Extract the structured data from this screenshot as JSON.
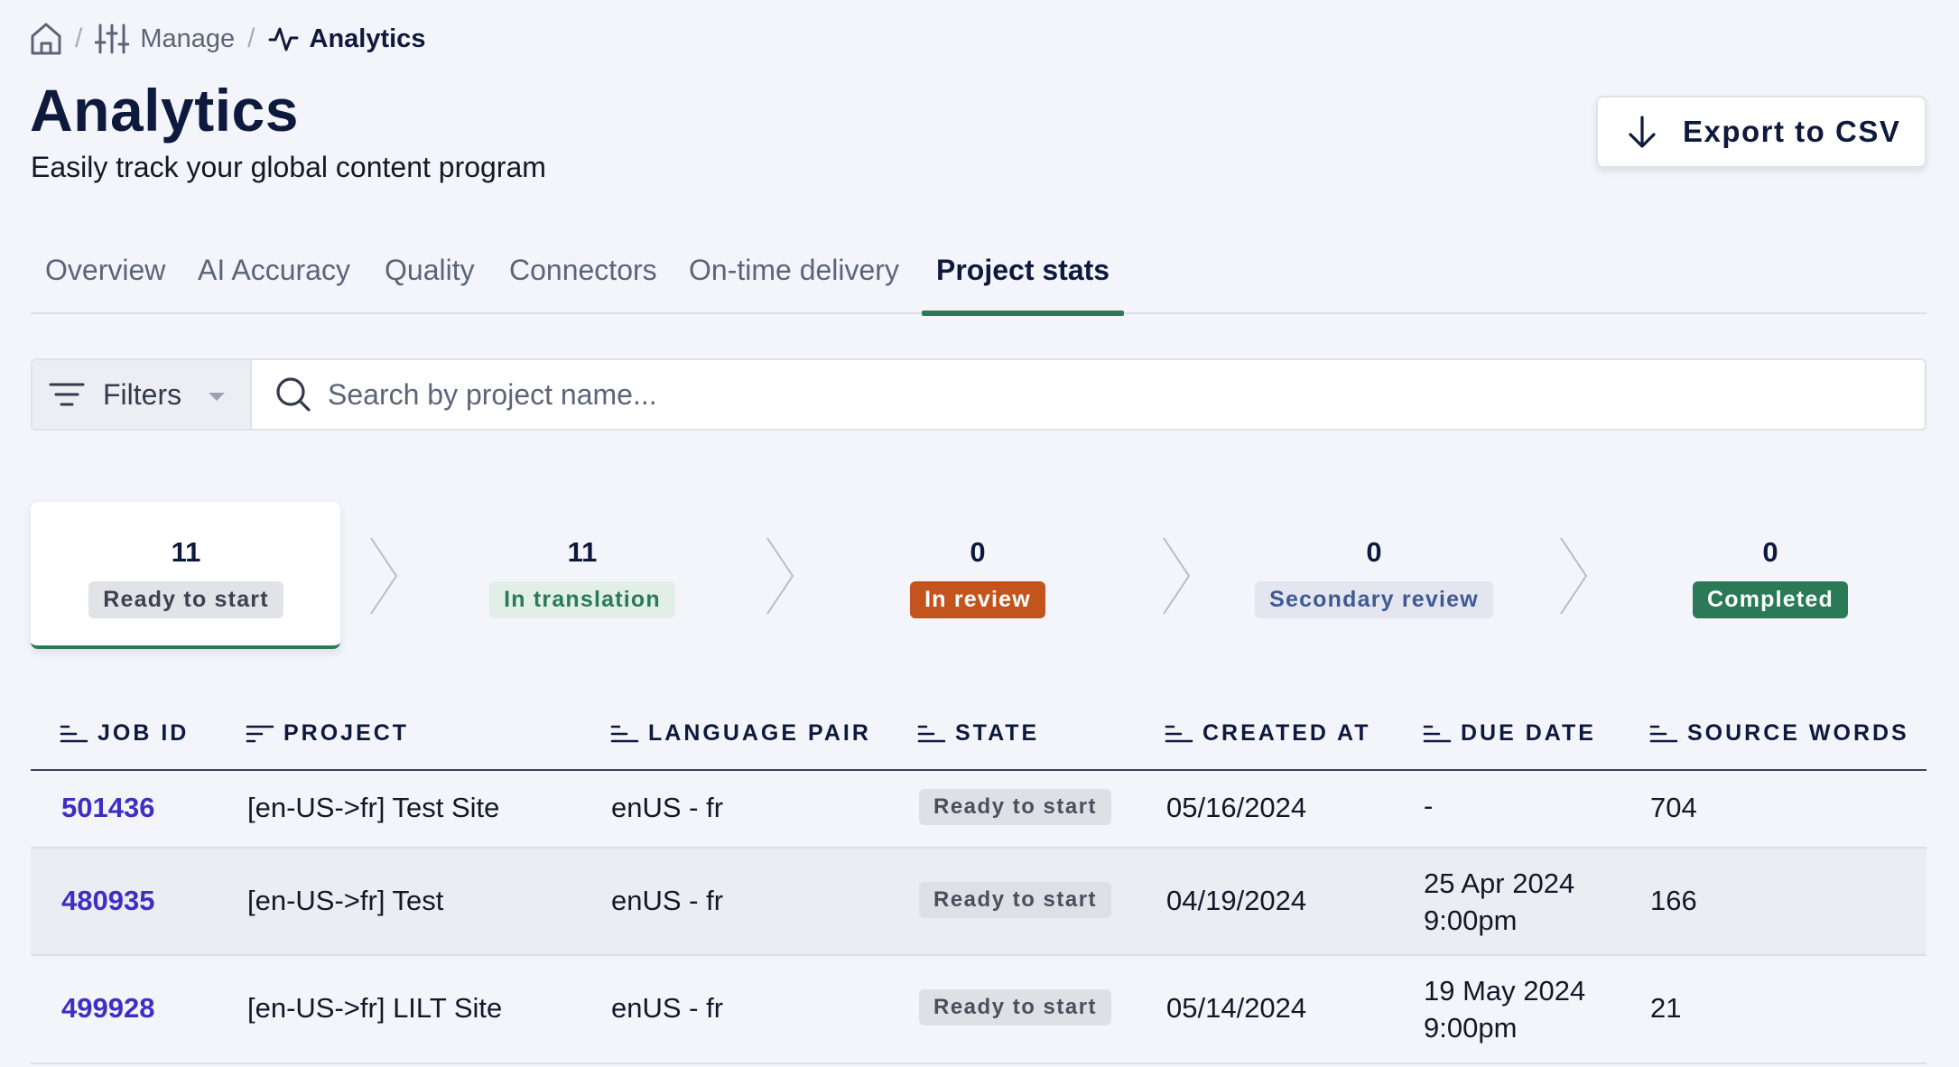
{
  "breadcrumb": {
    "home_icon": "home-icon",
    "manage_label": "Manage",
    "manage_icon": "sliders-icon",
    "current_label": "Analytics",
    "current_icon": "activity-icon",
    "separator": "/"
  },
  "header": {
    "title": "Analytics",
    "subtitle": "Easily track your global content program",
    "export_label": "Export to CSV",
    "export_icon": "download-arrow-icon"
  },
  "tabs": [
    {
      "label": "Overview",
      "active": false
    },
    {
      "label": "AI Accuracy",
      "active": false
    },
    {
      "label": "Quality",
      "active": false
    },
    {
      "label": "Connectors",
      "active": false
    },
    {
      "label": "On-time delivery",
      "active": false
    },
    {
      "label": "Project stats",
      "active": true
    }
  ],
  "filters": {
    "label": "Filters",
    "icon": "filter-lines-icon"
  },
  "search": {
    "placeholder": "Search by project name...",
    "value": "",
    "icon": "search-icon"
  },
  "pipeline": [
    {
      "count": "11",
      "label": "Ready to start",
      "selected": true,
      "bg": "#e2e3e8",
      "fg": "#3c4150"
    },
    {
      "count": "11",
      "label": "In translation",
      "selected": false,
      "bg": "#e1efe8",
      "fg": "#2a7a57"
    },
    {
      "count": "0",
      "label": "In review",
      "selected": false,
      "bg": "#c4541e",
      "fg": "#ffffff"
    },
    {
      "count": "0",
      "label": "Secondary review",
      "selected": false,
      "bg": "#e4e6ef",
      "fg": "#3f5a93"
    },
    {
      "count": "0",
      "label": "Completed",
      "selected": false,
      "bg": "#2a7a57",
      "fg": "#ffffff"
    }
  ],
  "table": {
    "columns": [
      "JOB ID",
      "PROJECT",
      "LANGUAGE PAIR",
      "STATE",
      "CREATED AT",
      "DUE DATE",
      "SOURCE WORDS"
    ],
    "rows": [
      {
        "job_id": "501436",
        "project": "[en-US->fr] Test Site",
        "language_pair": "enUS - fr",
        "state": "Ready to start",
        "created_at": "05/16/2024",
        "due_line1": "-",
        "due_line2": "",
        "source_words": "704"
      },
      {
        "job_id": "480935",
        "project": "[en-US->fr] Test",
        "language_pair": "enUS - fr",
        "state": "Ready to start",
        "created_at": "04/19/2024",
        "due_line1": "25 Apr 2024",
        "due_line2": "9:00pm",
        "source_words": "166"
      },
      {
        "job_id": "499928",
        "project": "[en-US->fr] LILT Site",
        "language_pair": "enUS - fr",
        "state": "Ready to start",
        "created_at": "05/14/2024",
        "due_line1": "19 May 2024",
        "due_line2": "9:00pm",
        "source_words": "21"
      }
    ]
  },
  "colors": {
    "accent_green": "#2a7a57",
    "link_purple": "#3d2fc4",
    "navy": "#0e1a3d",
    "background": "#f4f5fb"
  }
}
